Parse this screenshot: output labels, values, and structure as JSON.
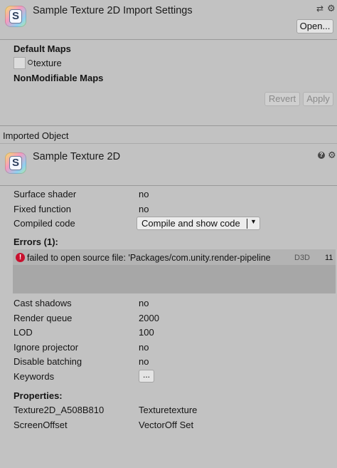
{
  "header": {
    "title": "Sample Texture 2D Import Settings",
    "open_button": "Open..."
  },
  "maps": {
    "default_title": "Default Maps",
    "texture_label": "texture",
    "nonmodifiable_title": "NonModifiable Maps"
  },
  "actions": {
    "revert": "Revert",
    "apply": "Apply"
  },
  "imported": {
    "section_label": "Imported Object",
    "title": "Sample Texture 2D"
  },
  "properties": [
    {
      "label": "Surface shader",
      "value": "no"
    },
    {
      "label": "Fixed function",
      "value": "no"
    },
    {
      "label": "Compiled code",
      "value": ""
    }
  ],
  "compile_dropdown": "Compile and show code",
  "errors": {
    "title": "Errors (1):",
    "message": "failed to open source file: 'Packages/com.unity.render-pipeline",
    "api": "D3D",
    "line": "11"
  },
  "properties2": [
    {
      "label": "Cast shadows",
      "value": "no"
    },
    {
      "label": "Render queue",
      "value": "2000"
    },
    {
      "label": "LOD",
      "value": "100"
    },
    {
      "label": "Ignore projector",
      "value": "no"
    },
    {
      "label": "Disable batching",
      "value": "no"
    },
    {
      "label": "Keywords",
      "value": ""
    }
  ],
  "keywords_button": "...",
  "shader_properties": {
    "title": "Properties:",
    "rows": [
      {
        "name": "Texture2D_A508B810",
        "value": "Texturetexture"
      },
      {
        "name": "ScreenOffset",
        "value": "VectorOff Set"
      }
    ]
  },
  "colors": {
    "background": "#c2c2c2",
    "error_red": "#c8102e"
  }
}
